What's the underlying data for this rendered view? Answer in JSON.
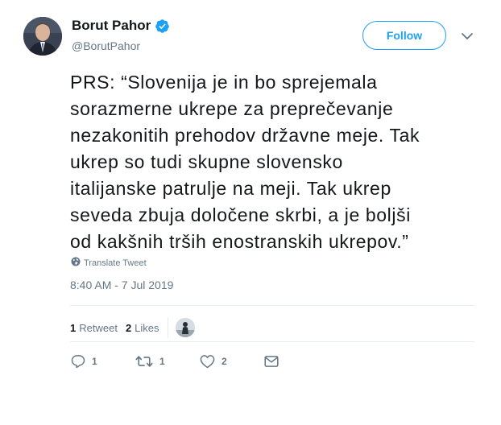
{
  "user": {
    "display_name": "Borut Pahor",
    "handle": "@BorutPahor",
    "verified": true
  },
  "follow_button": {
    "label": "Follow"
  },
  "tweet": {
    "lines": [
      "PRS: “Slovenija je in bo sprejemala",
      "sorazmerne ukrepe za preprečevanje",
      "nezakonitih prehodov državne meje. Tak",
      "ukrep so tudi skupne slovensko",
      "italijanske patrulje na meji. Tak ukrep",
      "seveda zbuja določene skrbi, a je boljši",
      "od kakšnih trših enostranskih ukrepov.”"
    ],
    "translate_label": "Translate Tweet",
    "timestamp": "8:40 AM - 7 Jul 2019"
  },
  "stats": {
    "retweets_count": "1",
    "retweets_label": "Retweet",
    "likes_count": "2",
    "likes_label": "Likes"
  },
  "actions": {
    "reply_count": "1",
    "retweet_count": "1",
    "like_count": "2"
  },
  "colors": {
    "accent": "#1da1f2",
    "text": "#14171a",
    "muted": "#657786",
    "divider": "#e6ecf0"
  },
  "icons": [
    "verified-badge-icon",
    "chevron-down-icon",
    "globe-icon",
    "reply-icon",
    "retweet-icon",
    "heart-icon",
    "envelope-icon"
  ]
}
